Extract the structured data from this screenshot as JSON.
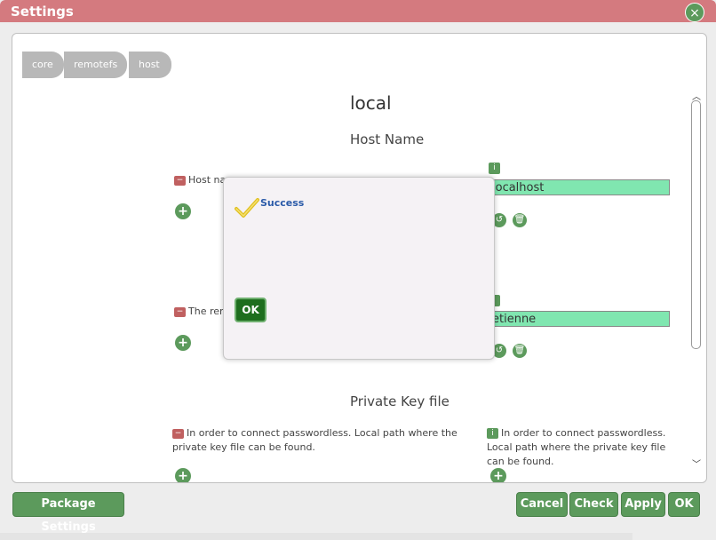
{
  "window": {
    "title": "Settings",
    "close_glyph": "×"
  },
  "breadcrumb": [
    "core",
    "remotefs",
    "host"
  ],
  "section": {
    "heading": "local",
    "host_name_title": "Host Name",
    "host_desc_left": "Host na",
    "host_value": "localhost",
    "user_desc_left": "The rem",
    "user_value": "etienne",
    "private_key_title": "Private Key file",
    "private_key_desc_left": "In order to connect passwordless. Local path where the private key file can be found.",
    "private_key_desc_right": "In order to connect passwordless. Local path where the private key file can be found."
  },
  "icons": {
    "minus": "minus-icon",
    "info": "info-icon",
    "plus": "plus-icon",
    "reset": "reset-icon",
    "delete": "trash-icon"
  },
  "dialog": {
    "message": "Success",
    "ok_label": "OK"
  },
  "footer": {
    "package_settings": "Package Settings",
    "cancel": "Cancel",
    "check": "Check",
    "apply": "Apply",
    "ok": "OK"
  },
  "colors": {
    "titlebar": "#d47a7f",
    "accent_green": "#5c9a5c",
    "field_bg": "#80e6b0",
    "dialog_ok": "#1e6e1e",
    "success_text": "#2a5aa8"
  }
}
